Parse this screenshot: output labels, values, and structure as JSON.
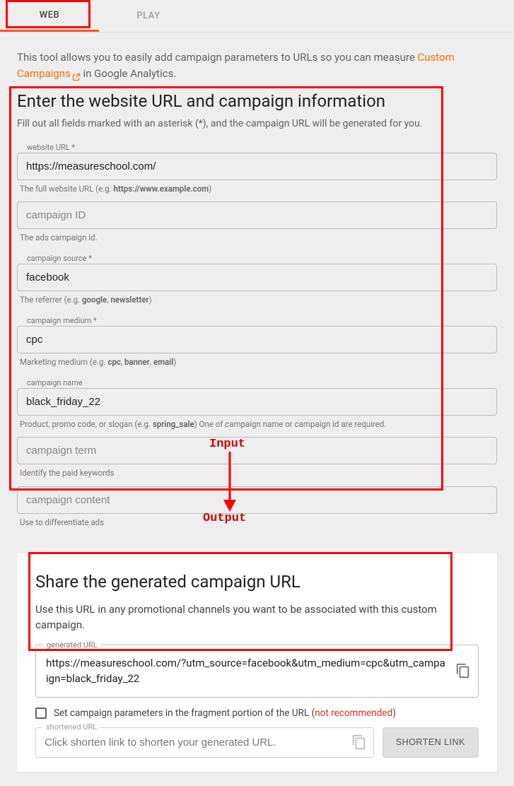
{
  "tabs": {
    "web": "WEB",
    "play": "PLAY"
  },
  "intro": {
    "text_before": "This tool allows you to easily add campaign parameters to URLs so you can measure ",
    "link": "Custom Campaigns",
    "text_after": " in Google Analytics."
  },
  "form": {
    "heading": "Enter the website URL and campaign information",
    "sub": "Fill out all fields marked with an asterisk (*), and the campaign URL will be generated for you.",
    "website_url": {
      "label": "website URL *",
      "value": "https://measureschool.com/",
      "helper_pre": "The full website URL (e.g. ",
      "helper_bold": "https://www.example.com",
      "helper_post": ")"
    },
    "campaign_id": {
      "placeholder": "campaign ID",
      "helper": "The ads campaign id."
    },
    "campaign_source": {
      "label": "campaign source *",
      "value": "facebook",
      "helper_pre": "The referrer (e.g. ",
      "helper_b1": "google",
      "helper_mid": ", ",
      "helper_b2": "newsletter",
      "helper_post": ")"
    },
    "campaign_medium": {
      "label": "campaign medium *",
      "value": "cpc",
      "helper_pre": "Marketing medium (e.g. ",
      "helper_b1": "cpc",
      "helper_m1": ", ",
      "helper_b2": "banner",
      "helper_m2": ", ",
      "helper_b3": "email",
      "helper_post": ")"
    },
    "campaign_name": {
      "label": "campaign name",
      "value": "black_friday_22",
      "helper_pre": "Product, promo code, or slogan (e.g. ",
      "helper_b1": "spring_sale",
      "helper_post": ") One of campaign name or campaign id are required."
    },
    "campaign_term": {
      "placeholder": "campaign term",
      "helper": "Identify the paid keywords"
    },
    "campaign_content": {
      "placeholder": "campaign content",
      "helper": "Use to differentiate ads"
    }
  },
  "share": {
    "heading": "Share the generated campaign URL",
    "desc": "Use this URL in any promotional channels you want to be associated with this custom campaign.",
    "gen_label": "generated URL",
    "gen_value": "https://measureschool.com/?utm_source=facebook&utm_medium=cpc&utm_campaign=black_friday_22",
    "fragment_label_pre": "Set campaign parameters in the fragment portion of the URL (",
    "fragment_not_rec": "not recommended",
    "fragment_label_post": ")",
    "short_label": "shortened URL",
    "short_placeholder": "Click shorten link to shorten your generated URL.",
    "shorten_btn": "SHORTEN LINK"
  },
  "annotations": {
    "input": "Input",
    "output": "Output"
  }
}
